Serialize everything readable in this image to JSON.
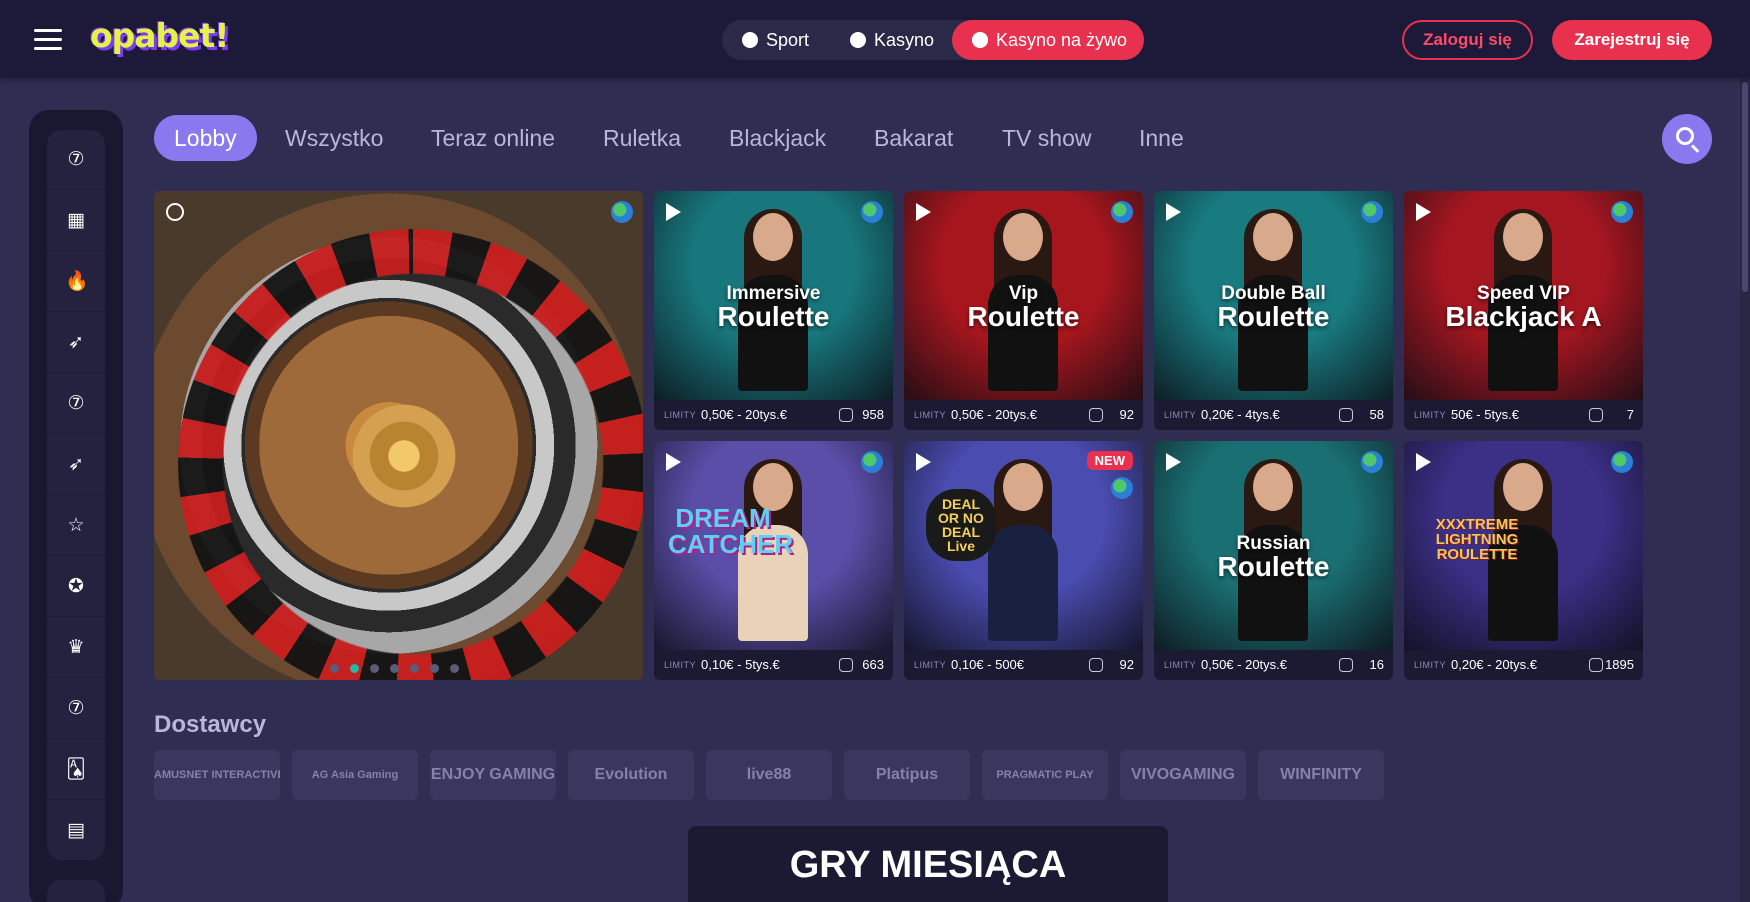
{
  "header": {
    "logo": "opabet!",
    "nav": [
      {
        "label": "Sport",
        "icon": "soccer-ball-icon"
      },
      {
        "label": "Kasyno",
        "icon": "slot-icon"
      },
      {
        "label": "Kasyno na żywo",
        "icon": "live-chip-icon",
        "active": true
      }
    ],
    "login": "Zaloguj się",
    "register": "Zarejestruj się"
  },
  "sidebar": {
    "items": [
      {
        "icon": "slot-7-icon",
        "glyph": "⑦"
      },
      {
        "icon": "grid-icon",
        "glyph": "▦"
      },
      {
        "icon": "flame-icon",
        "glyph": "🔥"
      },
      {
        "icon": "rocket-icon",
        "glyph": "➶"
      },
      {
        "icon": "slot-7-icon",
        "glyph": "⑦"
      },
      {
        "icon": "rocket-icon",
        "glyph": "➶"
      },
      {
        "icon": "star-icon",
        "glyph": "☆"
      },
      {
        "icon": "gift-icon",
        "glyph": "✪"
      },
      {
        "icon": "trophy-icon",
        "glyph": "♛"
      },
      {
        "icon": "sevens-icon",
        "glyph": "⑦"
      },
      {
        "icon": "cards-icon",
        "glyph": "🂡"
      },
      {
        "icon": "wallet-icon",
        "glyph": "▤"
      }
    ]
  },
  "tabs": [
    "Lobby",
    "Wszystko",
    "Teraz online",
    "Ruletka",
    "Blackjack",
    "Bakarat",
    "TV show",
    "Inne"
  ],
  "hero": {
    "slides": 7,
    "active_slide": 2
  },
  "limit_label": "LIMITY",
  "games": [
    {
      "title_small": "Immersive",
      "title_big": "Roulette",
      "limits": "0,50€ - 20tys.€",
      "players": "958",
      "bg": "#17777c",
      "dress": "#111"
    },
    {
      "title_small": "Vip",
      "title_big": "Roulette",
      "limits": "0,50€ - 20tys.€",
      "players": "92",
      "bg": "#a8161d",
      "dress": "#111"
    },
    {
      "title_small": "Double Ball",
      "title_big": "Roulette",
      "limits": "0,20€ - 4tys.€",
      "players": "58",
      "bg": "#187b80",
      "dress": "#111"
    },
    {
      "title_small": "Speed VIP",
      "title_big": "Blackjack A",
      "limits": "50€ - 5tys.€",
      "players": "7",
      "bg": "#a41620",
      "dress": "#111"
    },
    {
      "title_small": "",
      "title_big": "",
      "brand": "DREAM CATCHER",
      "limits": "0,10€ - 5tys.€",
      "players": "663",
      "bg": "#5a4ea8",
      "dress": "#e8d2b8"
    },
    {
      "title_small": "",
      "title_big": "",
      "brand": "DEAL OR NO DEAL Live",
      "limits": "0,10€ - 500€",
      "players": "92",
      "bg": "#4a4cb0",
      "dress": "#1a2140",
      "new": "NEW"
    },
    {
      "title_small": "Russian",
      "title_big": "Roulette",
      "limits": "0,50€ - 20tys.€",
      "players": "16",
      "bg": "#1a6f72",
      "dress": "#111"
    },
    {
      "title_small": "",
      "title_big": "",
      "brand": "XXXTREME LIGHTNING ROULETTE",
      "limits": "0,20€ - 20tys.€",
      "players": "1895",
      "bg": "#3b2f86",
      "dress": "#111"
    }
  ],
  "providers_title": "Dostawcy",
  "providers": [
    "AMUSNET INTERACTIVE",
    "AG Asia Gaming",
    "ENJOY GAMING",
    "Evolution",
    "live88",
    "Platipus",
    "PRAGMATIC PLAY",
    "VIVOGAMING",
    "WINFINITY"
  ],
  "games_of_month": "GRY MIESIĄCA",
  "colors": {
    "accent": "#e8304f",
    "purple": "#8a79ee",
    "bg": "#302d52"
  }
}
